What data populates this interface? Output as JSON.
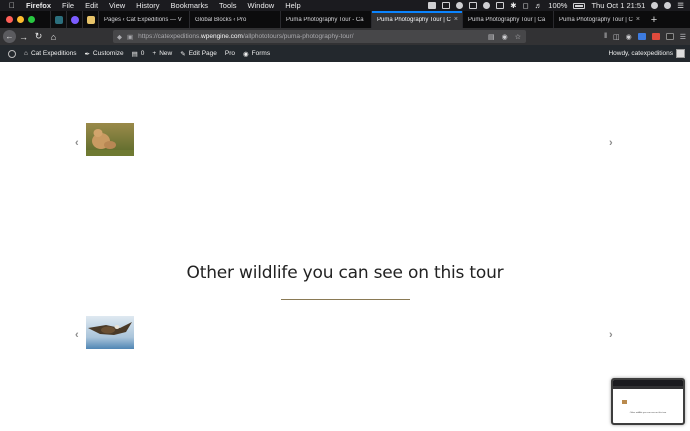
{
  "menubar": {
    "app": "Firefox",
    "items": [
      "File",
      "Edit",
      "View",
      "History",
      "Bookmarks",
      "Tools",
      "Window",
      "Help"
    ],
    "battery": "100%",
    "clock": "Thu Oct 1  21:51"
  },
  "tabs": [
    {
      "title": "Pages ‹ Cat Expeditions — V",
      "active": false
    },
    {
      "title": "Global Blocks ‹ Pro",
      "active": false
    },
    {
      "title": "Puma Photography Tour - Ca",
      "active": false
    },
    {
      "title": "Puma Photography Tour | Ca",
      "active": true
    },
    {
      "title": "Puma Photography Tour | Ca",
      "active": false
    },
    {
      "title": "Puma Photography Tour | Ca",
      "active": false
    }
  ],
  "url": {
    "prefix": "https://catexpeditions.",
    "host": "wpengine.com",
    "path": "/allphototours/puma-photography-tour/"
  },
  "adminbar": {
    "site": "Cat Expeditions",
    "customize": "Customize",
    "comments": "0",
    "new": "New",
    "edit": "Edit Page",
    "pro": "Pro",
    "forms": "Forms",
    "howdy": "Howdy, catexpeditions"
  },
  "page": {
    "heading": "Other wildlife you can see on this tour"
  },
  "colors": {
    "menubar": "#1b1b1f",
    "tabstrip": "#0c0c0d",
    "toolbar": "#323234",
    "adminbar": "#23282d",
    "accent": "#0a84ff",
    "rule": "#8a7a55"
  }
}
